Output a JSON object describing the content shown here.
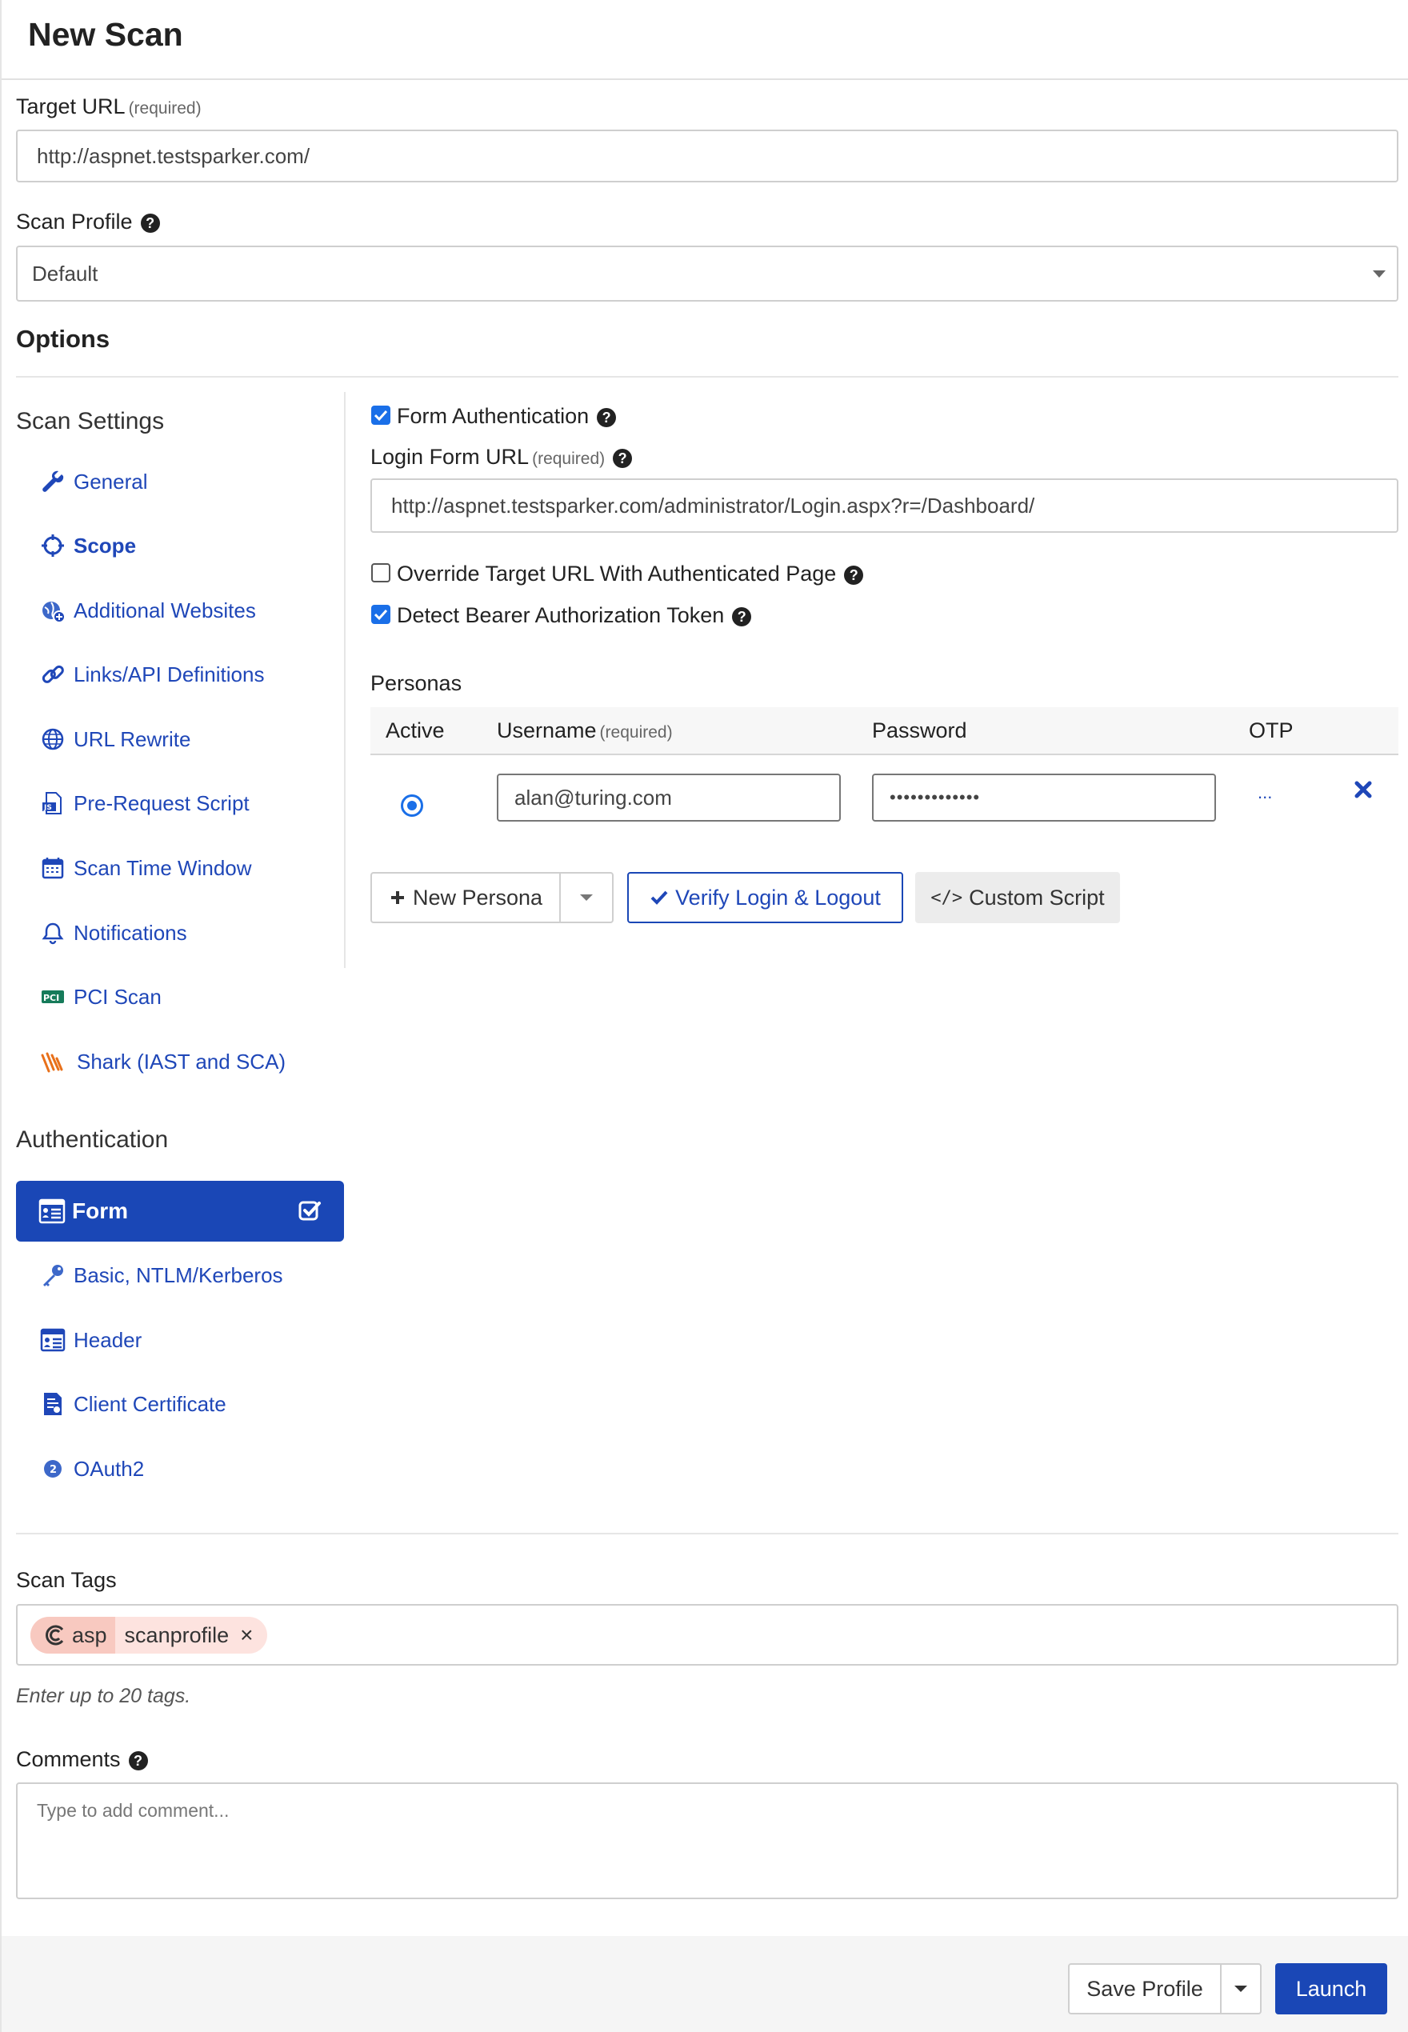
{
  "title": "New Scan",
  "target_url": {
    "label": "Target URL",
    "required": "(required)",
    "value": "http://aspnet.testsparker.com/"
  },
  "scan_profile": {
    "label": "Scan Profile",
    "value": "Default"
  },
  "options_label": "Options",
  "scan_settings": {
    "heading": "Scan Settings",
    "items": [
      {
        "label": "General",
        "icon": "wrench-icon"
      },
      {
        "label": "Scope",
        "icon": "crosshair-icon"
      },
      {
        "label": "Additional Websites",
        "icon": "globe-plus-icon"
      },
      {
        "label": "Links/API Definitions",
        "icon": "link-icon"
      },
      {
        "label": "URL Rewrite",
        "icon": "globe-icon"
      },
      {
        "label": "Pre-Request Script",
        "icon": "js-file-icon"
      },
      {
        "label": "Scan Time Window",
        "icon": "calendar-icon"
      },
      {
        "label": "Notifications",
        "icon": "bell-icon"
      },
      {
        "label": "PCI Scan",
        "icon": "pci-icon"
      },
      {
        "label": "Shark (IAST and SCA)",
        "icon": "shark-icon"
      }
    ]
  },
  "authentication": {
    "heading": "Authentication",
    "items": [
      {
        "label": "Form",
        "icon": "form-icon"
      },
      {
        "label": "Basic, NTLM/Kerberos",
        "icon": "key-icon"
      },
      {
        "label": "Header",
        "icon": "header-icon"
      },
      {
        "label": "Client Certificate",
        "icon": "certificate-icon"
      },
      {
        "label": "OAuth2",
        "icon": "oauth2-icon"
      }
    ]
  },
  "form_auth": {
    "enabled_label": "Form Authentication",
    "login_form_url_label": "Login Form URL",
    "required": "(required)",
    "login_form_url": "http://aspnet.testsparker.com/administrator/Login.aspx?r=/Dashboard/",
    "override_label": "Override Target URL With Authenticated Page",
    "bearer_label": "Detect Bearer Authorization Token",
    "personas_heading": "Personas",
    "columns": {
      "active": "Active",
      "username": "Username",
      "username_req": "(required)",
      "password": "Password",
      "otp": "OTP"
    },
    "persona": {
      "username": "alan@turing.com",
      "password": "•••••••••••••",
      "otp": "..."
    },
    "buttons": {
      "new_persona": "New Persona",
      "verify": "Verify Login & Logout",
      "custom_script": "Custom Script"
    }
  },
  "scan_tags": {
    "label": "Scan Tags",
    "tag_prefix": "asp",
    "tag_value": "scanprofile",
    "remove": "×",
    "hint": "Enter up to 20 tags."
  },
  "comments": {
    "label": "Comments",
    "placeholder": "Type to add comment..."
  },
  "footer": {
    "save_profile": "Save Profile",
    "launch": "Launch"
  },
  "colors": {
    "primary": "#1a47b6",
    "link": "#1f47b8",
    "checkbox": "#1a6fe8",
    "tag_bg": "#fde3df"
  }
}
